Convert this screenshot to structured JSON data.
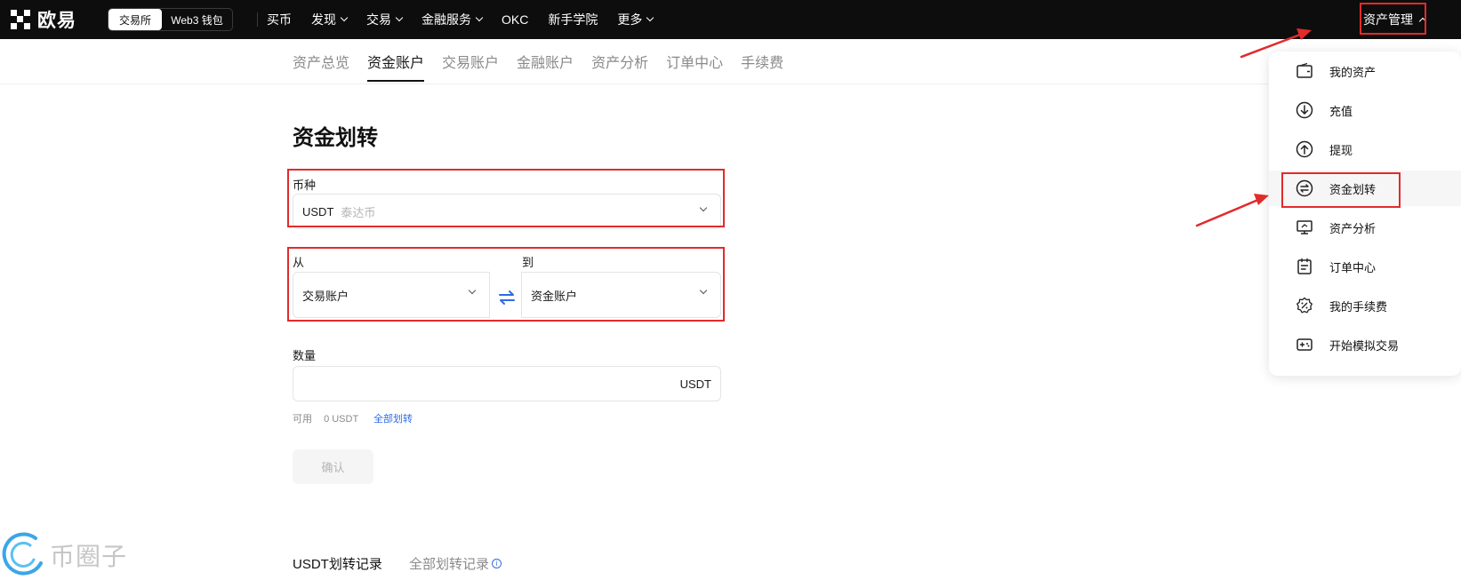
{
  "header": {
    "logo_text": "欧易",
    "segment": {
      "exchange": "交易所",
      "web3": "Web3 钱包"
    },
    "nav": [
      {
        "label": "买币",
        "has_dropdown": false
      },
      {
        "label": "发现",
        "has_dropdown": true
      },
      {
        "label": "交易",
        "has_dropdown": true
      },
      {
        "label": "金融服务",
        "has_dropdown": true
      },
      {
        "label": "OKC",
        "has_dropdown": false
      },
      {
        "label": "新手学院",
        "has_dropdown": false
      },
      {
        "label": "更多",
        "has_dropdown": true
      }
    ],
    "asset_management": "资产管理"
  },
  "subtabs": [
    {
      "label": "资产总览",
      "active": false
    },
    {
      "label": "资金账户",
      "active": true
    },
    {
      "label": "交易账户",
      "active": false
    },
    {
      "label": "金融账户",
      "active": false
    },
    {
      "label": "资产分析",
      "active": false
    },
    {
      "label": "订单中心",
      "active": false
    },
    {
      "label": "手续费",
      "active": false
    }
  ],
  "form": {
    "title": "资金划转",
    "currency_label": "币种",
    "currency_value": "USDT",
    "currency_hint": "泰达币",
    "from_label": "从",
    "from_value": "交易账户",
    "to_label": "到",
    "to_value": "资金账户",
    "amount_label": "数量",
    "amount_unit": "USDT",
    "available_label": "可用",
    "available_value": "0 USDT",
    "transfer_all": "全部划转",
    "confirm": "确认"
  },
  "records": {
    "tab_current": "USDT划转记录",
    "tab_all": "全部划转记录"
  },
  "watermark": {
    "text": "币圈子"
  },
  "dropdown": {
    "items": [
      {
        "label": "我的资产",
        "icon": "wallet-icon"
      },
      {
        "label": "充值",
        "icon": "deposit-icon"
      },
      {
        "label": "提现",
        "icon": "withdraw-icon"
      },
      {
        "label": "资金划转",
        "icon": "transfer-icon"
      },
      {
        "label": "资产分析",
        "icon": "analysis-icon"
      },
      {
        "label": "订单中心",
        "icon": "order-icon"
      },
      {
        "label": "我的手续费",
        "icon": "fee-icon"
      },
      {
        "label": "开始模拟交易",
        "icon": "demo-trading-icon"
      }
    ],
    "active_index": 3
  },
  "colors": {
    "header_bg": "#0d0d0d",
    "highlight_red": "#e22b2b",
    "link_blue": "#2e6ae6",
    "muted_text": "#8a8a8a"
  }
}
